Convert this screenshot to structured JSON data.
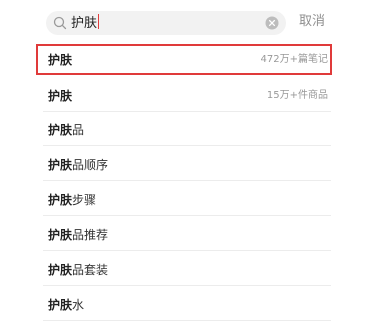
{
  "search": {
    "query": "护肤",
    "cancel_label": "取消"
  },
  "suggestions": [
    {
      "bold": "护肤",
      "rest": "",
      "meta": "472万+篇笔记"
    },
    {
      "bold": "护肤",
      "rest": "",
      "meta": "15万+件商品"
    },
    {
      "bold": "护肤",
      "rest": "品",
      "meta": ""
    },
    {
      "bold": "护肤",
      "rest": "品顺序",
      "meta": ""
    },
    {
      "bold": "护肤",
      "rest": "步骤",
      "meta": ""
    },
    {
      "bold": "护肤",
      "rest": "品推荐",
      "meta": ""
    },
    {
      "bold": "护肤",
      "rest": "品套装",
      "meta": ""
    },
    {
      "bold": "护肤",
      "rest": "水",
      "meta": ""
    }
  ],
  "colors": {
    "highlight_border": "#e03a3a",
    "caret": "#e23c3c",
    "search_bg": "#f2f2f2"
  },
  "icons": {
    "search": "search-icon",
    "clear": "clear-icon"
  }
}
